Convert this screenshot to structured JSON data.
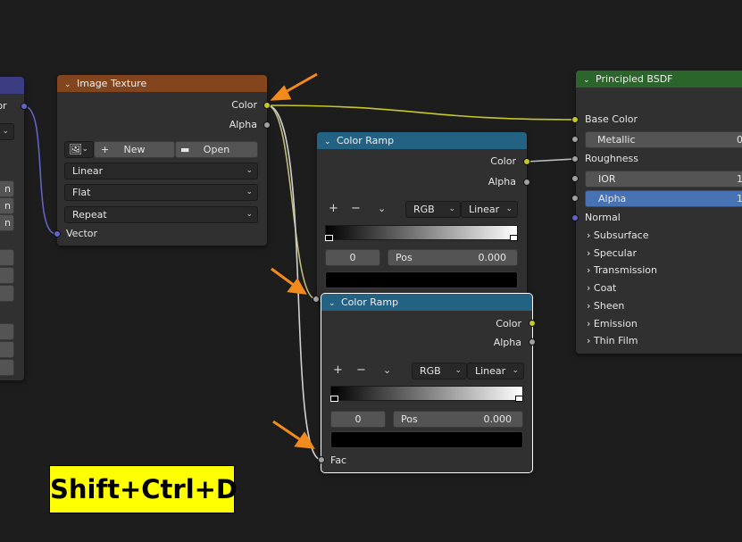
{
  "left_node": {
    "socket_label_partial": "tor",
    "field_glyph": "n"
  },
  "image_texture": {
    "title": "Image Texture",
    "header_color": "#83451d",
    "out_color": "Color",
    "out_alpha": "Alpha",
    "new_label": "New",
    "open_label": "Open",
    "interpolation": "Linear",
    "projection": "Flat",
    "extension": "Repeat",
    "in_vector": "Vector"
  },
  "color_ramp_1": {
    "title": "Color Ramp",
    "header_color": "#246283",
    "out_color": "Color",
    "out_alpha": "Alpha",
    "add": "+",
    "remove": "−",
    "color_mode": "RGB",
    "interpolation": "Linear",
    "index": "0",
    "pos_label": "Pos",
    "pos_value": "0.000"
  },
  "color_ramp_2": {
    "title": "Color Ramp",
    "header_color": "#246283",
    "out_color": "Color",
    "out_alpha": "Alpha",
    "add": "+",
    "remove": "−",
    "color_mode": "RGB",
    "interpolation": "Linear",
    "index": "0",
    "pos_label": "Pos",
    "pos_value": "0.000",
    "in_fac": "Fac"
  },
  "bsdf": {
    "title": "Principled BSDF",
    "header_color": "#2b652b",
    "base_color": "Base Color",
    "metallic": "Metallic",
    "metallic_val": "0",
    "roughness": "Roughness",
    "ior": "IOR",
    "ior_val": "1",
    "alpha": "Alpha",
    "alpha_val": "1",
    "normal": "Normal",
    "panels": [
      "Subsurface",
      "Specular",
      "Transmission",
      "Coat",
      "Sheen",
      "Emission",
      "Thin Film"
    ]
  },
  "shortcut": "Shift+Ctrl+D",
  "colors": {
    "socket_color": "#c7c729",
    "socket_float": "#a1a1a1",
    "socket_vector": "#6363c7",
    "arrow": "#f28a1c",
    "alpha_highlight": "#4772b3"
  }
}
